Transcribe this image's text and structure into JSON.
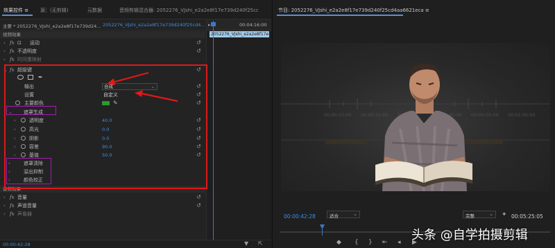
{
  "left_panel": {
    "tabs": [
      {
        "label": "效果控件 ≡"
      },
      {
        "label": "源：(无剪辑)"
      },
      {
        "label": "元数据"
      },
      {
        "label": "音频剪辑混合器: 2052276_VJshi_e2a2e8f17e739d240f25cd4aa66"
      }
    ],
    "source_label": "主要 * 2052276_VJshi_e2a2e8f17e739d24...",
    "sequence_label": "2052276_VJshi_e2a2e8f17e739d240f25cd4...",
    "timeline": {
      "end_time": "00:04:16:00",
      "clip_label": "2052276_VJshi_e2a2e8f17e7"
    },
    "sections": {
      "video": "视频效果",
      "audio": "音频效果"
    },
    "effects": {
      "motion": "运动",
      "opacity": "不透明度",
      "time_remap": "时间重映射",
      "ultra_key": "超级键",
      "volume": "音量",
      "channel_volume": "声道音量",
      "panner": "声像器"
    },
    "keyer": {
      "output_label": "输出",
      "output_value": "合成",
      "setting_label": "设置",
      "setting_value": "自定义",
      "key_color_label": "主要颜色",
      "matte_generation": "遮罩生成",
      "transparency": {
        "label": "透明度",
        "value": "40.0"
      },
      "highlight": {
        "label": "高光",
        "value": "0.0"
      },
      "shadow": {
        "label": "阴影",
        "value": "0.0"
      },
      "tolerance": {
        "label": "容差",
        "value": "90.0"
      },
      "pedestal": {
        "label": "基值",
        "value": "50.0"
      },
      "matte_cleanup": "遮罩清除",
      "spill_suppression": "溢出抑制",
      "color_correction": "颜色校正"
    },
    "footer_time": "00:00:42:28",
    "colors": {
      "highlight_box": "#e01919",
      "group_box": "#a21fb0",
      "value_blue": "#3d8ee6",
      "key_color": "#2d9a2d"
    }
  },
  "program_monitor": {
    "title": "节目: 2052276_VJshi_e2a2e8f17e739d240f25cd4aa6621eca ≡",
    "current_time": "00:00:42:28",
    "zoom": "适合",
    "quality": "完整",
    "duration": "00:05:25:05",
    "bg_timestamps": [
      "00:00:10:00",
      "00:00:20:00",
      "00:00:30:00",
      "00:00:40:00",
      "00:00:50:00",
      "00:01:00:00"
    ]
  },
  "watermark": "头条 @自学拍摄剪辑"
}
